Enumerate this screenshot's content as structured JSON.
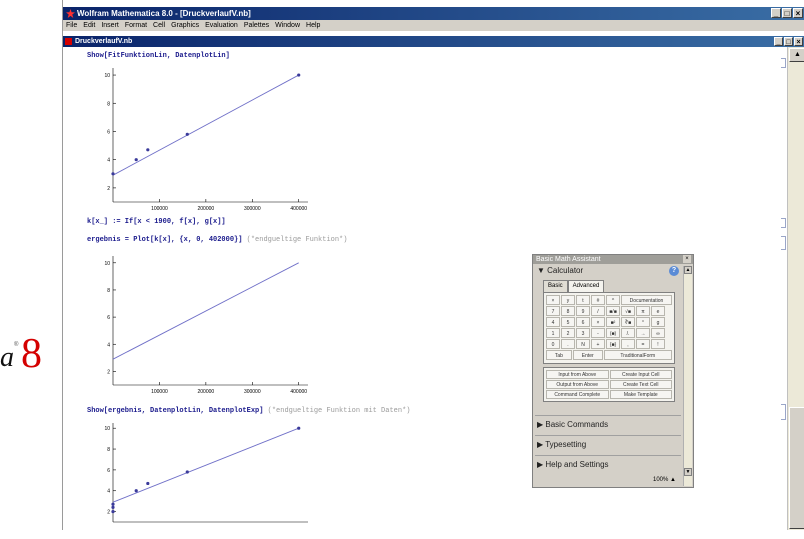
{
  "window": {
    "title": "Wolfram Mathematica 8.0 - [DruckverlaufV.nb]",
    "min": "_",
    "max": "□",
    "close": "×"
  },
  "menu": [
    "File",
    "Edit",
    "Insert",
    "Format",
    "Cell",
    "Graphics",
    "Evaluation",
    "Palettes",
    "Window",
    "Help"
  ],
  "notebook": {
    "title": "DruckverlaufV.nb",
    "cells": [
      {
        "code": "Show[FitFunktionLin, DatenplotLin]",
        "comment": ""
      },
      {
        "code": "k[x_] := If[x < 1900, f[x], g[x]]",
        "comment": ""
      },
      {
        "code": "ergebnis = Plot[k[x], {x, 0, 402000}]",
        "comment": "(*endgueltige Funktion*)"
      },
      {
        "code": "Show[ergebnis, DatenplotLin, DatenplotExp]",
        "comment": "(*endgueltige Funktion mit Daten*)"
      }
    ]
  },
  "plots": [
    {
      "yticks": [
        "2",
        "4",
        "6",
        "8",
        "10"
      ],
      "xticks": [
        "100000",
        "200000",
        "300000",
        "400000"
      ],
      "line": [
        [
          0,
          2.9
        ],
        [
          400000,
          10
        ]
      ],
      "points": [
        [
          0,
          3
        ],
        [
          50000,
          4
        ],
        [
          75000,
          4.7
        ],
        [
          160000,
          5.8
        ],
        [
          400000,
          10
        ]
      ]
    },
    {
      "yticks": [
        "2",
        "4",
        "6",
        "8",
        "10"
      ],
      "xticks": [
        "100000",
        "200000",
        "300000",
        "400000"
      ],
      "line": [
        [
          0,
          2.9
        ],
        [
          400000,
          10
        ]
      ],
      "points": []
    },
    {
      "yticks": [
        "2",
        "4",
        "6",
        "8",
        "10"
      ],
      "xticks": [],
      "line": [
        [
          0,
          2.9
        ],
        [
          400000,
          10
        ]
      ],
      "points": [
        [
          0,
          2
        ],
        [
          0,
          2.4
        ],
        [
          0,
          2.7
        ],
        [
          50000,
          4
        ],
        [
          75000,
          4.7
        ],
        [
          160000,
          5.8
        ],
        [
          400000,
          10
        ]
      ]
    }
  ],
  "logo": {
    "text": "a",
    "mark": "®",
    "version": "8"
  },
  "palette": {
    "title": "Basic Math Assistant",
    "close": "×",
    "calculator": "▼ Calculator",
    "help": "?",
    "tabs": [
      "Basic",
      "Advanced"
    ],
    "keys": [
      [
        "×",
        "y",
        "t",
        "#",
        "^",
        "Documentation"
      ],
      [
        "7",
        "8",
        "9",
        "/",
        "■/■",
        "√■",
        "π",
        "e"
      ],
      [
        "4",
        "5",
        "6",
        "×",
        "■²",
        "∛■",
        "°",
        "g"
      ],
      [
        "1",
        "2",
        "3",
        "-",
        "(■)",
        "/.",
        "→",
        "∞"
      ],
      [
        "0",
        ".",
        "N",
        "+",
        "{■}",
        ",",
        "=",
        "!"
      ],
      [
        "Tab",
        "Enter",
        "TraditionalForm"
      ]
    ],
    "commands": [
      "Input from Above",
      "Create Input Cell",
      "Output from Above",
      "Create Text Cell",
      "Command Complete",
      "Make Template"
    ],
    "sections": [
      "▶ Basic Commands",
      "▶ Typesetting",
      "▶ Help and Settings"
    ],
    "zoom": "100%  ▲"
  },
  "colors": {
    "accent": "#0a246a",
    "plot": "#7070c8",
    "code": "#1a1a8c",
    "logo": "#d40000"
  }
}
